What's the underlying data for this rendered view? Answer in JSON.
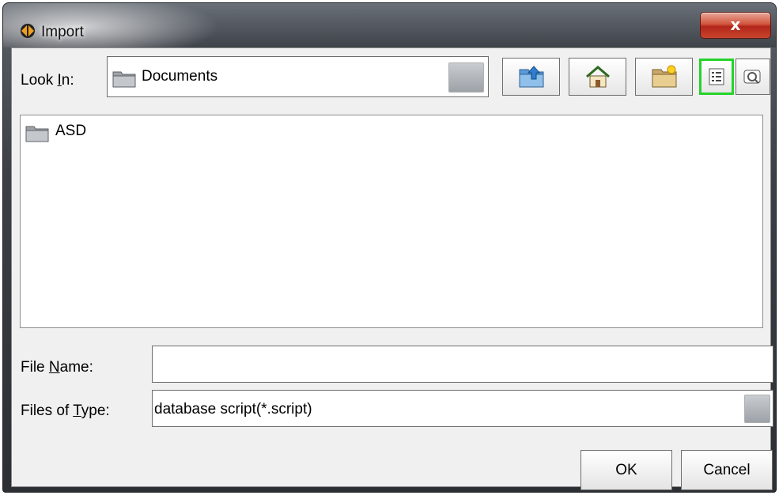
{
  "window": {
    "title": "Import",
    "close_label": "x",
    "icons": {
      "app": "app-logo-icon",
      "close": "close-icon"
    }
  },
  "look_in": {
    "label_prefix": "Look ",
    "label_mnemonic": "I",
    "label_suffix": "n:",
    "value": "Documents",
    "icon": "folder-icon"
  },
  "toolbar": {
    "buttons": [
      {
        "name": "up-one-level-button",
        "icon": "up-folder-icon"
      },
      {
        "name": "home-button",
        "icon": "home-icon"
      },
      {
        "name": "new-folder-button",
        "icon": "new-folder-icon"
      },
      {
        "name": "list-view-button",
        "icon": "list-view-icon",
        "selected": true
      },
      {
        "name": "details-view-button",
        "icon": "details-view-icon",
        "selected": false
      }
    ],
    "selected_color": "#25d32a"
  },
  "file_list": {
    "items": [
      {
        "label": "ASD",
        "icon": "folder-icon"
      }
    ]
  },
  "file_name": {
    "label_prefix": "File ",
    "label_mnemonic": "N",
    "label_suffix": "ame:",
    "value": ""
  },
  "file_type": {
    "label_prefix": "Files of ",
    "label_mnemonic": "T",
    "label_suffix": "ype:",
    "value": "database script(*.script)"
  },
  "buttons": {
    "ok": "OK",
    "cancel": "Cancel"
  }
}
